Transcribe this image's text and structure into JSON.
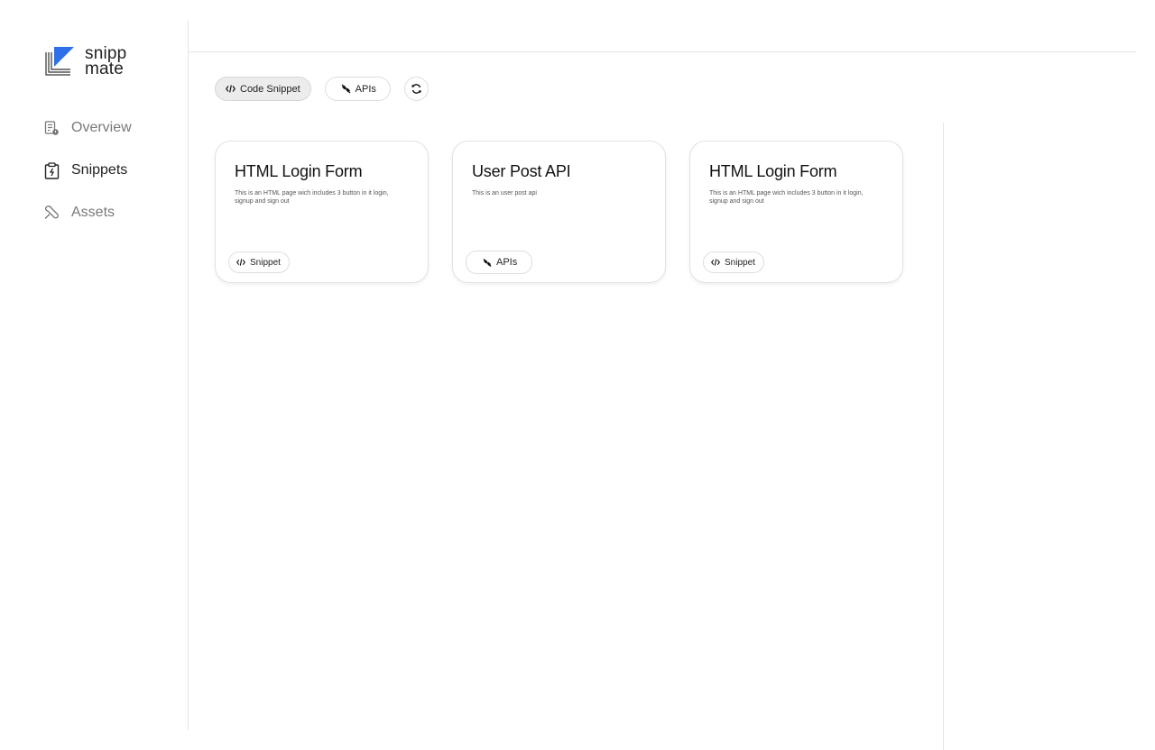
{
  "brand": {
    "line1": "snipp",
    "line2": "mate",
    "accent_color": "#2f6fe8"
  },
  "sidebar": {
    "items": [
      {
        "label": "Overview",
        "icon": "overview-doc-icon",
        "active": false
      },
      {
        "label": "Snippets",
        "icon": "snippets-clipboard-icon",
        "active": true
      },
      {
        "label": "Assets",
        "icon": "assets-wrench-icon",
        "active": false
      }
    ]
  },
  "filters": {
    "code_snippet_label": "Code Snippet",
    "apis_label": "APIs",
    "refresh_icon": "refresh-icon"
  },
  "cards": [
    {
      "title": "HTML Login Form",
      "description": "This is an HTML page wich includes 3 button in it login, signup and sign out",
      "tag": "Snippet",
      "tag_icon": "code-icon"
    },
    {
      "title": "User Post API",
      "description": "This is an user post api",
      "tag": "APIs",
      "tag_icon": "plug-icon"
    },
    {
      "title": "HTML Login Form",
      "description": "This is an HTML page wich includes 3 button in it login, signup and sign out",
      "tag": "Snippet",
      "tag_icon": "code-icon"
    }
  ]
}
